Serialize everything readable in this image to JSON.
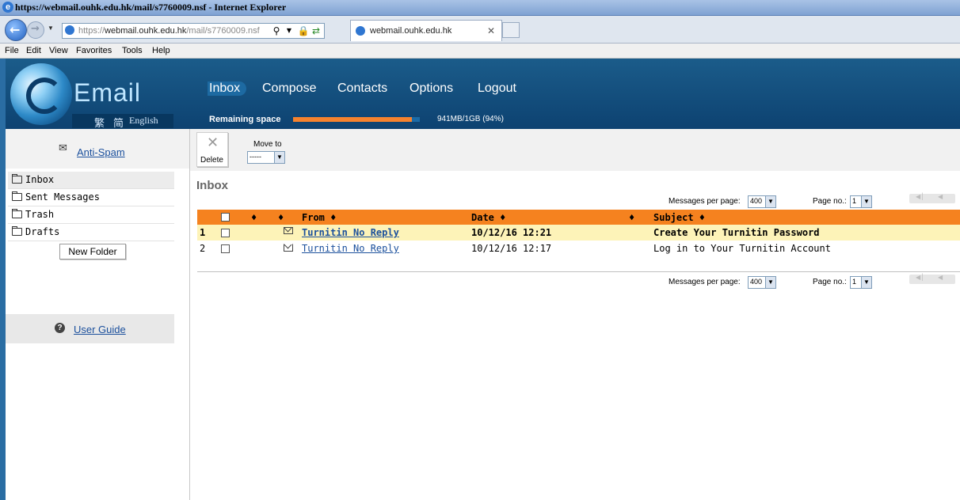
{
  "browser": {
    "window_title": "https://webmail.ouhk.edu.hk/mail/s7760009.nsf - Internet Explorer",
    "address_prefix": "https://",
    "address_host": "webmail.ouhk.edu.hk",
    "address_path": "/mail/s7760009.nsf",
    "tab_title": "webmail.ouhk.edu.hk",
    "menu": [
      "File",
      "Edit",
      "View",
      "Favorites",
      "Tools",
      "Help"
    ]
  },
  "header": {
    "brand": "Email",
    "languages": [
      "繁",
      "简",
      "English"
    ],
    "nav": [
      "Inbox",
      "Compose",
      "Contacts",
      "Options",
      "Logout"
    ],
    "active_nav": "Inbox",
    "remaining_label": "Remaining space",
    "quota_text": "941MB/1GB (94%)",
    "quota_fraction": 0.94,
    "colors": {
      "header": "#0d4271",
      "accent": "#f5821f",
      "link": "#1a4f9c"
    }
  },
  "sidebar": {
    "antispam": "Anti-Spam",
    "folders": [
      "Inbox",
      "Sent Messages",
      "Trash",
      "Drafts"
    ],
    "selected_folder": "Inbox",
    "new_folder": "New Folder",
    "user_guide": "User Guide"
  },
  "toolbar": {
    "delete": "Delete",
    "move_to": "Move to",
    "move_to_value": "-----"
  },
  "main": {
    "title": "Inbox",
    "per_page_label": "Messages per page:",
    "per_page_value": "400",
    "page_no_label": "Page no.:",
    "page_no_value": "1",
    "columns": {
      "from": "From ♦",
      "date": "Date ♦",
      "subject": "Subject ♦",
      "sort": "♦"
    },
    "rows": [
      {
        "num": "1",
        "from": "Turnitin No Reply",
        "date": "10/12/16 12:21",
        "subject": "Create Your Turnitin Password",
        "unread": true,
        "icon": "closed-envelope-icon"
      },
      {
        "num": "2",
        "from": "Turnitin No Reply",
        "date": "10/12/16 12:17",
        "subject": "Log in to Your Turnitin Account",
        "unread": false,
        "icon": "open-envelope-icon"
      }
    ]
  }
}
